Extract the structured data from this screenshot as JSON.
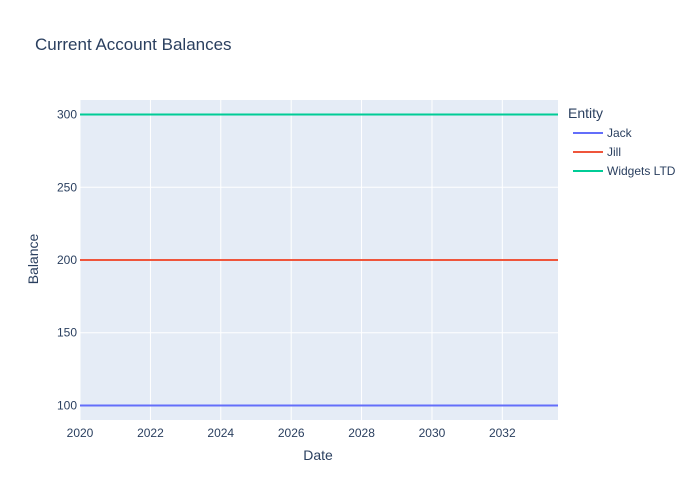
{
  "chart_data": {
    "type": "line",
    "title": "Current Account Balances",
    "xlabel": "Date",
    "ylabel": "Balance",
    "legend_title": "Entity",
    "legend_position": "right",
    "grid": true,
    "xlim": [
      "2020-01-01",
      "2033-08-01"
    ],
    "ylim": [
      90,
      310
    ],
    "x_ticks": [
      "2020",
      "2022",
      "2024",
      "2026",
      "2028",
      "2030",
      "2032"
    ],
    "y_ticks": [
      100,
      150,
      200,
      250,
      300
    ],
    "series": [
      {
        "name": "Jack",
        "color": "#636efa",
        "x": [
          "2020-01-01",
          "2033-08-01"
        ],
        "y": [
          100,
          100
        ]
      },
      {
        "name": "Jill",
        "color": "#ef553b",
        "x": [
          "2020-01-01",
          "2033-08-01"
        ],
        "y": [
          200,
          200
        ]
      },
      {
        "name": "Widgets LTD",
        "color": "#00cc96",
        "x": [
          "2020-01-01",
          "2033-08-01"
        ],
        "y": [
          300,
          300
        ]
      }
    ],
    "plot_background": "#e5ecf6",
    "gridline_color": "#ffffff"
  }
}
